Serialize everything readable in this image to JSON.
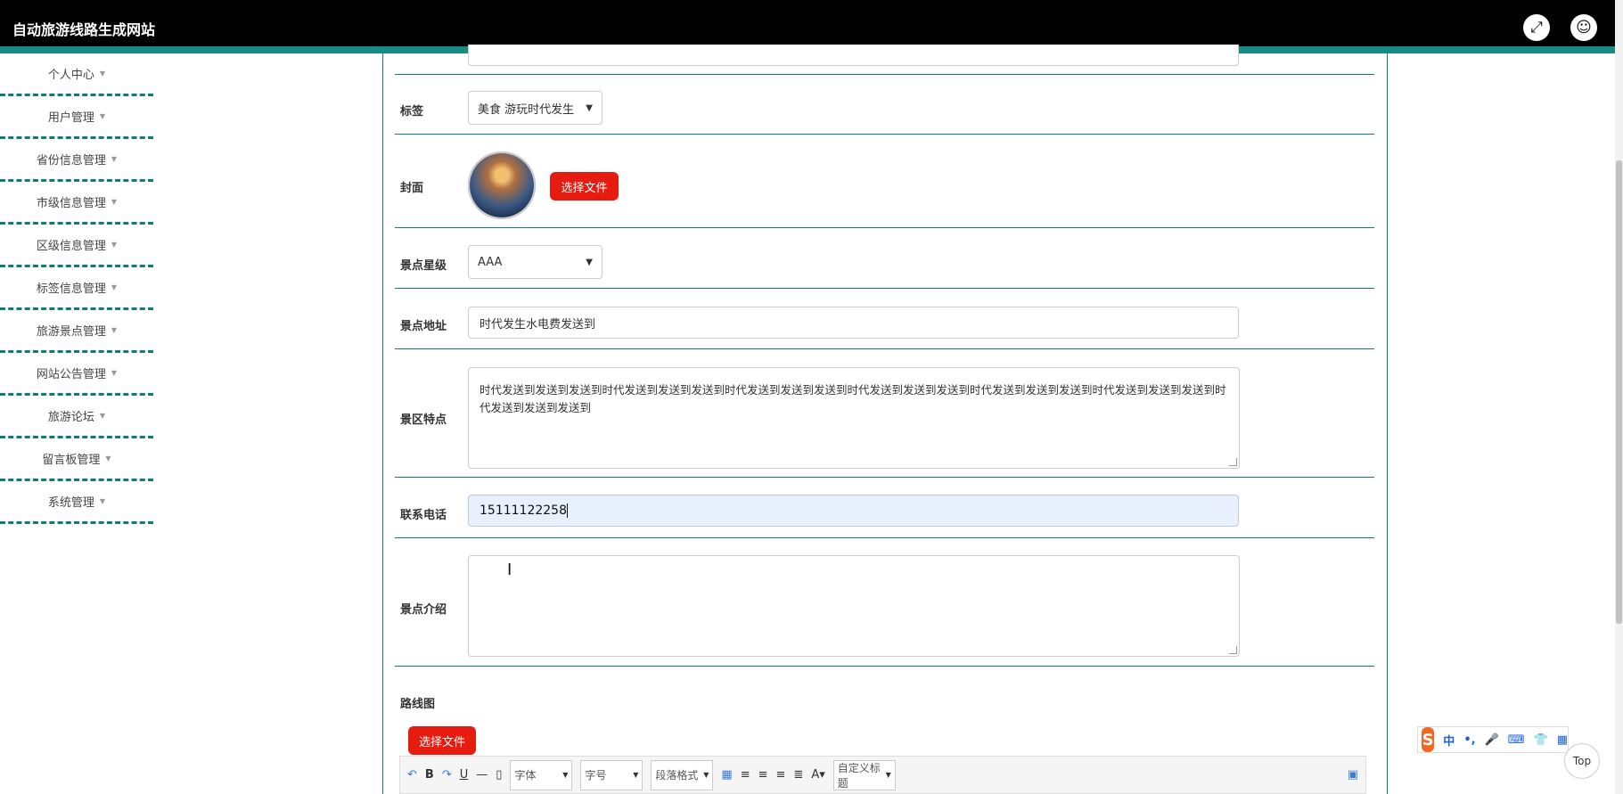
{
  "header": {
    "title": "自动旅游线路生成网站",
    "expand_icon": "expand-icon",
    "user_icon": "user-icon"
  },
  "sidebar": {
    "items": [
      {
        "label": "个人中心"
      },
      {
        "label": "用户管理"
      },
      {
        "label": "省份信息管理"
      },
      {
        "label": "市级信息管理"
      },
      {
        "label": "区级信息管理"
      },
      {
        "label": "标签信息管理"
      },
      {
        "label": "旅游景点管理"
      },
      {
        "label": "网站公告管理"
      },
      {
        "label": "旅游论坛"
      },
      {
        "label": "留言板管理"
      },
      {
        "label": "系统管理"
      }
    ]
  },
  "form": {
    "tags": {
      "label": "标签",
      "value": "美食 游玩时代发生"
    },
    "cover": {
      "label": "封面",
      "button": "选择文件"
    },
    "stars": {
      "label": "景点星级",
      "value": "AAA"
    },
    "address": {
      "label": "景点地址",
      "value": "时代发生水电费发送到"
    },
    "features": {
      "label": "景区特点",
      "value": "时代发送到发送到发送到时代发送到发送到发送到时代发送到发送到发送到时代发送到发送到发送到时代发送到发送到发送到时代发送到发送到发送到时代发送到发送到发送到"
    },
    "phone": {
      "label": "联系电话",
      "value": "15111122258"
    },
    "intro": {
      "label": "景点介绍",
      "value": ""
    },
    "route": {
      "label": "路线图",
      "button": "选择文件"
    }
  },
  "editor": {
    "font_label": "字体",
    "size_label": "字号",
    "paragraph_label": "段落格式",
    "custom_title_label": "自定义标题"
  },
  "ime": {
    "lang": "中"
  },
  "back_to_top": "Top",
  "colors": {
    "accent": "#0b7c76",
    "button": "#e51c0f",
    "header": "#000000"
  }
}
